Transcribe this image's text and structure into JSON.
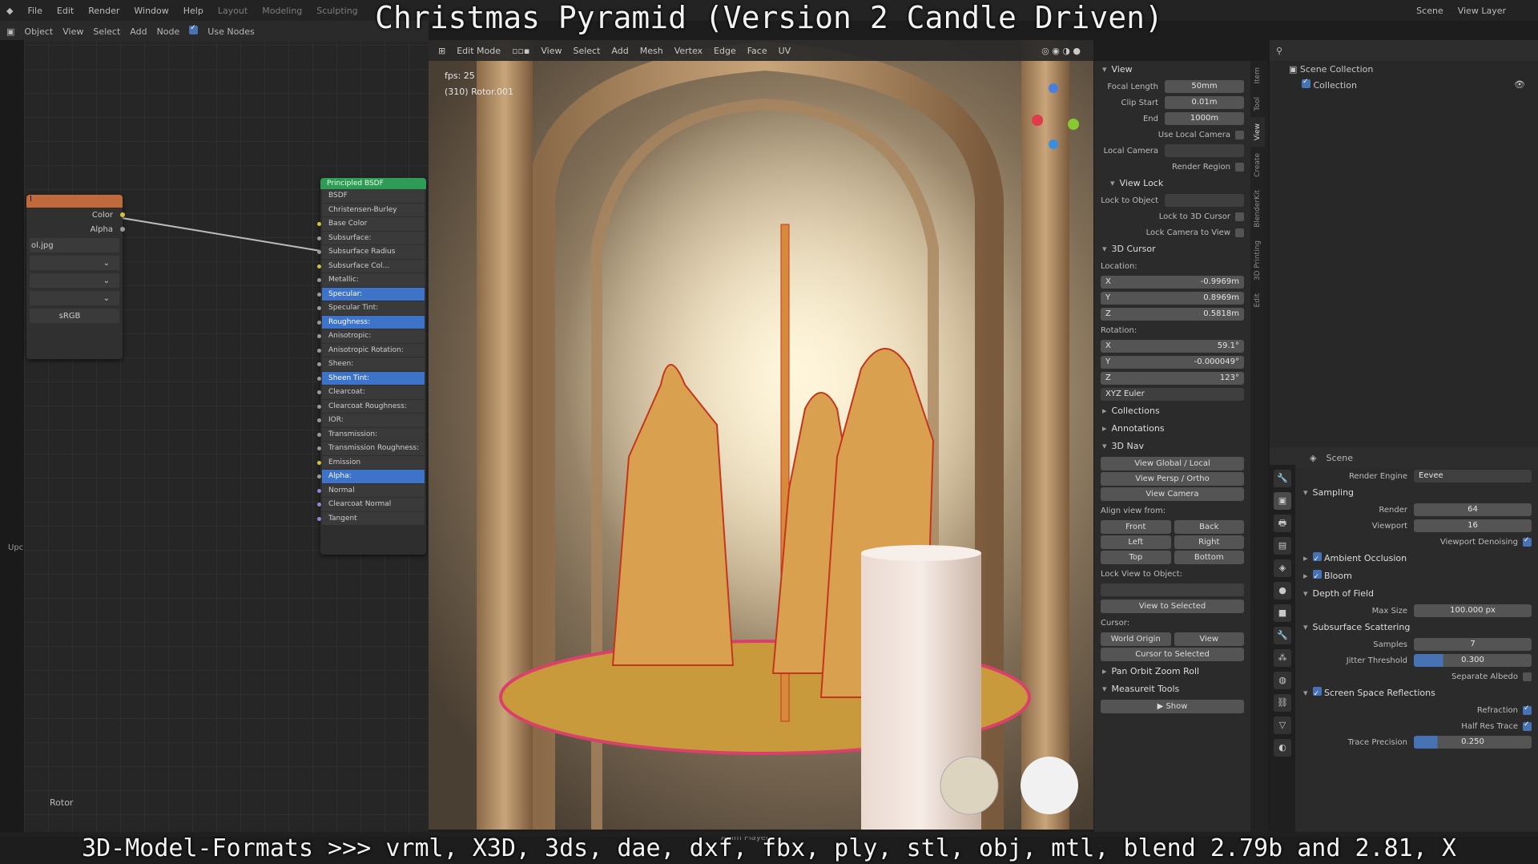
{
  "overlay": {
    "title": "Christmas Pyramid (Version 2 Candle Driven)",
    "bottom_caption": "3D-Model-Formats >>> vrml, X3D, 3ds, dae, dxf, fbx, ply, stl, obj, mtl, blend 2.79b and 2.81, X"
  },
  "topbar": {
    "menus": [
      "File",
      "Edit",
      "Render",
      "Window",
      "Help"
    ],
    "workspaces": [
      "Layout",
      "Modeling",
      "Sculpting"
    ],
    "scene": "Scene",
    "view_layer": "View Layer"
  },
  "node_editor": {
    "header": [
      "Object",
      "View",
      "Select",
      "Add",
      "Node",
      "Use Nodes"
    ],
    "image_node": {
      "outputs": [
        "Color",
        "Alpha"
      ],
      "file": "ol.jpg",
      "colorspace": "sRGB"
    },
    "bsdf_node": {
      "title": "Principled BSDF",
      "rows": [
        "BSDF",
        "Christensen-Burley",
        "Base Color",
        "Subsurface:",
        "Subsurface Radius",
        "Subsurface Col...",
        "Metallic:",
        "Specular:",
        "Specular Tint:",
        "Roughness:",
        "Anisotropic:",
        "Anisotropic Rotation:",
        "Sheen:",
        "Sheen Tint:",
        "Clearcoat:",
        "Clearcoat Roughness:",
        "IOR:",
        "Transmission:",
        "Transmission Roughness:",
        "Emission",
        "Alpha:",
        "Normal",
        "Clearcoat Normal",
        "Tangent"
      ],
      "highlighted": [
        7,
        9,
        13,
        20
      ]
    },
    "frame_label": "Rotor",
    "side_label": "Upc"
  },
  "viewport": {
    "mode": "Edit Mode",
    "menus": [
      "View",
      "Select",
      "Add",
      "Mesh",
      "Vertex",
      "Edge",
      "Face",
      "UV"
    ],
    "fps": "fps: 25",
    "object": "(310) Rotor.001",
    "footer": "Anim Player"
  },
  "npanel": {
    "tabs": [
      "Item",
      "Tool",
      "View",
      "Create",
      "BlenderKit",
      "3D Printing",
      "Edit"
    ],
    "view_section": "View",
    "focal_length": {
      "label": "Focal Length",
      "value": "50mm"
    },
    "clip_start": {
      "label": "Clip Start",
      "value": "0.01m"
    },
    "clip_end": {
      "label": "End",
      "value": "1000m"
    },
    "use_local_camera": "Use Local Camera",
    "local_camera": "Local Camera",
    "render_region": "Render Region",
    "view_lock": "View Lock",
    "lock_to_object": "Lock to Object",
    "lock_3d_cursor": "Lock to 3D Cursor",
    "lock_camera": "Lock Camera to View",
    "cursor_section": "3D Cursor",
    "location_label": "Location:",
    "loc": [
      {
        "axis": "X",
        "value": "-0.9969m"
      },
      {
        "axis": "Y",
        "value": "0.8969m"
      },
      {
        "axis": "Z",
        "value": "0.5818m"
      }
    ],
    "rotation_label": "Rotation:",
    "rot": [
      {
        "axis": "X",
        "value": "59.1°"
      },
      {
        "axis": "Y",
        "value": "-0.000049°"
      },
      {
        "axis": "Z",
        "value": "123°"
      }
    ],
    "euler": "XYZ Euler",
    "collections": "Collections",
    "annotations": "Annotations",
    "nav": "3D Nav",
    "view_global": "View Global / Local",
    "view_persp": "View Persp / Ortho",
    "view_camera": "View Camera",
    "align_from": "Align view from:",
    "align": [
      "Front",
      "Back",
      "Left",
      "Right",
      "Top",
      "Bottom"
    ],
    "lock_view_obj": "Lock View to Object:",
    "view_selected": "View to Selected",
    "cursor": "Cursor:",
    "world_origin": "World Origin",
    "view": "View",
    "cursor_selected": "Cursor to Selected",
    "pan_orbit": "Pan Orbit Zoom Roll",
    "measure": "Measureit Tools",
    "show": "Show"
  },
  "outliner": {
    "scene_collection": "Scene Collection",
    "collection": "Collection"
  },
  "properties": {
    "scene": "Scene",
    "render_engine_label": "Render Engine",
    "render_engine": "Eevee",
    "sampling": "Sampling",
    "render_label": "Render",
    "render_val": "64",
    "viewport_label": "Viewport",
    "viewport_val": "16",
    "denoise": "Viewport Denoising",
    "ao": "Ambient Occlusion",
    "bloom": "Bloom",
    "dof": "Depth of Field",
    "max_size_label": "Max Size",
    "max_size": "100.000 px",
    "sss": "Subsurface Scattering",
    "samples_label": "Samples",
    "samples": "7",
    "jitter_label": "Jitter Threshold",
    "jitter": "0.300",
    "sep_albedo": "Separate Albedo",
    "ssr": "Screen Space Reflections",
    "refraction": "Refraction",
    "half_res": "Half Res Trace",
    "trace_prec_label": "Trace Precision",
    "trace_prec": "0.250"
  }
}
